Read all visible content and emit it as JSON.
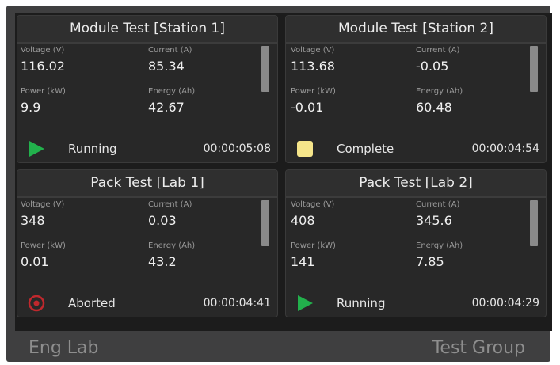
{
  "cards": [
    {
      "title": "Module Test [Station 1]",
      "voltage_label": "Voltage (V)",
      "voltage": "116.02",
      "current_label": "Current (A)",
      "current": "85.34",
      "power_label": "Power (kW)",
      "power": "9.9",
      "energy_label": "Energy (Ah)",
      "energy": "42.67",
      "status": "Running",
      "status_icon": "play-icon",
      "status_color": "#22b14c",
      "elapsed": "00:00:05:08"
    },
    {
      "title": "Module Test [Station 2]",
      "voltage_label": "Voltage (V)",
      "voltage": "113.68",
      "current_label": "Current (A)",
      "current": "-0.05",
      "power_label": "Power (kW)",
      "power": "-0.01",
      "energy_label": "Energy (Ah)",
      "energy": "60.48",
      "status": "Complete",
      "status_icon": "square-icon",
      "status_color": "#f5e58a",
      "elapsed": "00:00:04:54"
    },
    {
      "title": "Pack Test [Lab 1]",
      "voltage_label": "Voltage (V)",
      "voltage": "348",
      "current_label": "Current (A)",
      "current": "0.03",
      "power_label": "Power (kW)",
      "power": "0.01",
      "energy_label": "Energy (Ah)",
      "energy": "43.2",
      "status": "Aborted",
      "status_icon": "target-icon",
      "status_color": "#c0282d",
      "elapsed": "00:00:04:41"
    },
    {
      "title": "Pack Test [Lab 2]",
      "voltage_label": "Voltage (V)",
      "voltage": "408",
      "current_label": "Current (A)",
      "current": "345.6",
      "power_label": "Power (kW)",
      "power": "141",
      "energy_label": "Energy (Ah)",
      "energy": "7.85",
      "status": "Running",
      "status_icon": "play-icon",
      "status_color": "#22b14c",
      "elapsed": "00:00:04:29"
    }
  ],
  "footer": {
    "left": "Eng Lab",
    "right": "Test Group"
  },
  "colors": {
    "frame": "#3f3f40",
    "panel_background": "#1c1c1c",
    "card_background": "#282828"
  }
}
